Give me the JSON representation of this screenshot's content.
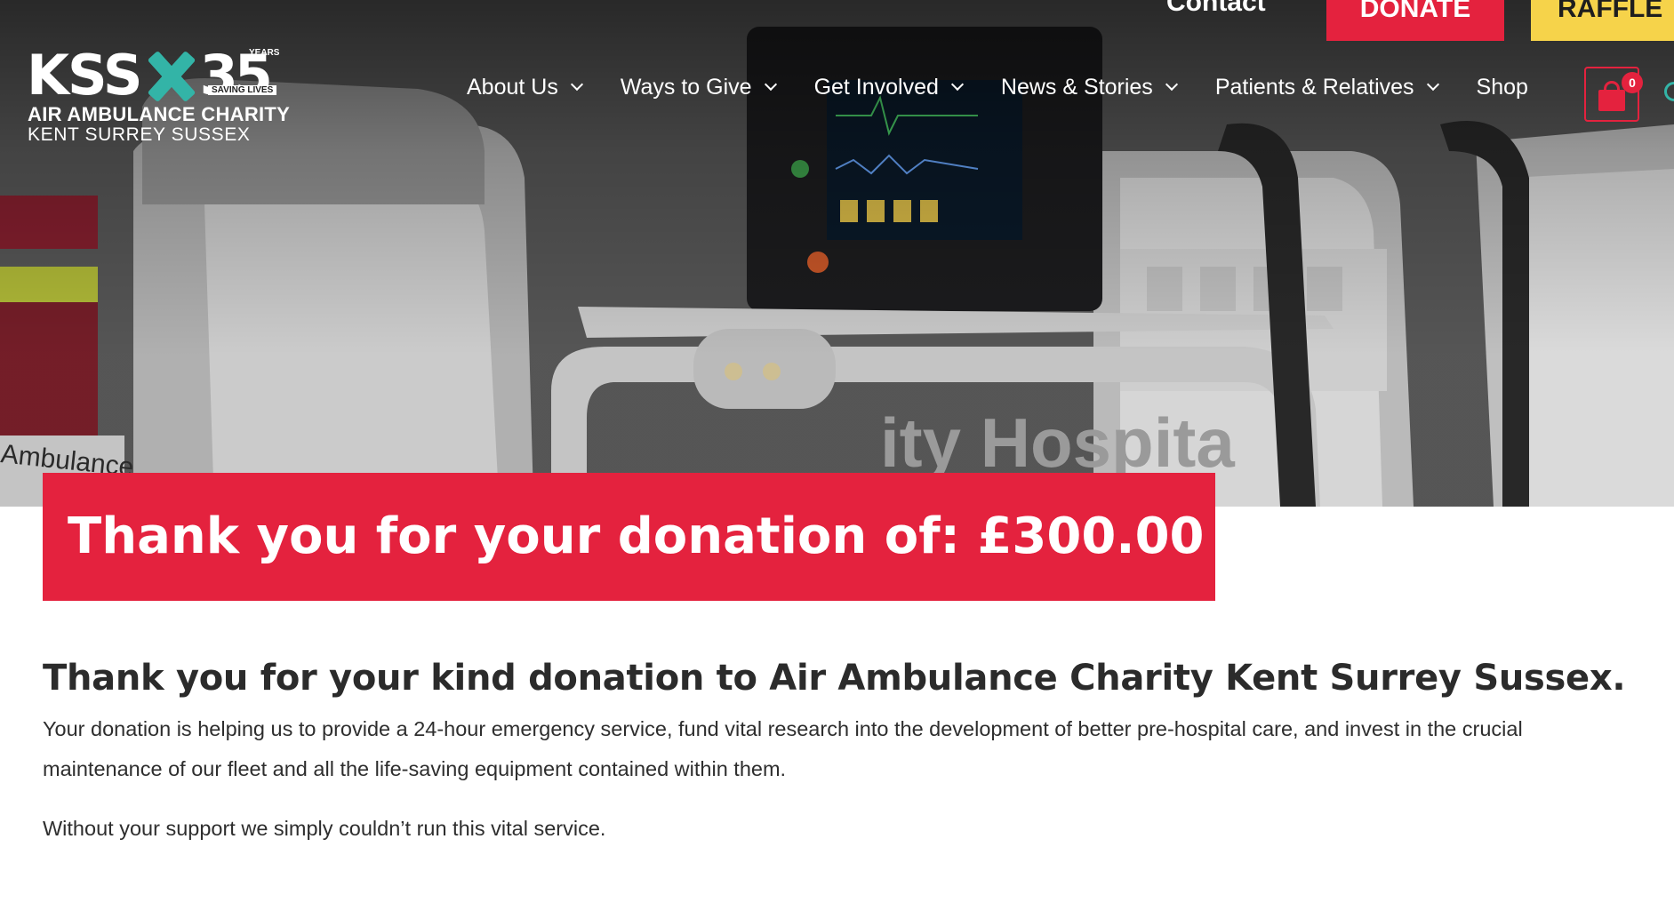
{
  "logo": {
    "kss": "KSS",
    "number": "35",
    "years": "YEARS",
    "tagline": "SAVING LIVES",
    "line1": "AIR AMBULANCE CHARITY",
    "line2": "KENT SURREY SUSSEX"
  },
  "utility": {
    "contact": "Contact",
    "donate": "DONATE",
    "raffle": "RAFFLE"
  },
  "nav": {
    "items": [
      {
        "label": "About Us",
        "dropdown": true
      },
      {
        "label": "Ways to Give",
        "dropdown": true
      },
      {
        "label": "Get Involved",
        "dropdown": true
      },
      {
        "label": "News & Stories",
        "dropdown": true
      },
      {
        "label": "Patients & Relatives",
        "dropdown": true
      },
      {
        "label": "Shop",
        "dropdown": false
      }
    ],
    "cart_count": "0"
  },
  "hero_image_text": {
    "ambulance": "Ambulance",
    "hospital": "ity Hospita"
  },
  "banner": {
    "text": "Thank you for your donation of: £300.00"
  },
  "content": {
    "heading": "Thank you for your kind donation to Air Ambulance Charity Kent Surrey Sussex.",
    "para1": "Your donation is helping us to provide a 24-hour emergency service, fund vital research into the development of better pre-hospital care, and invest in the crucial maintenance of our fleet and all the life-saving equipment contained within them.",
    "para2": "Without your support we simply couldn’t run this vital service."
  },
  "colors": {
    "brand_red": "#e4223e",
    "raffle_yellow": "#f6d34a",
    "teal": "#33b4a7"
  }
}
